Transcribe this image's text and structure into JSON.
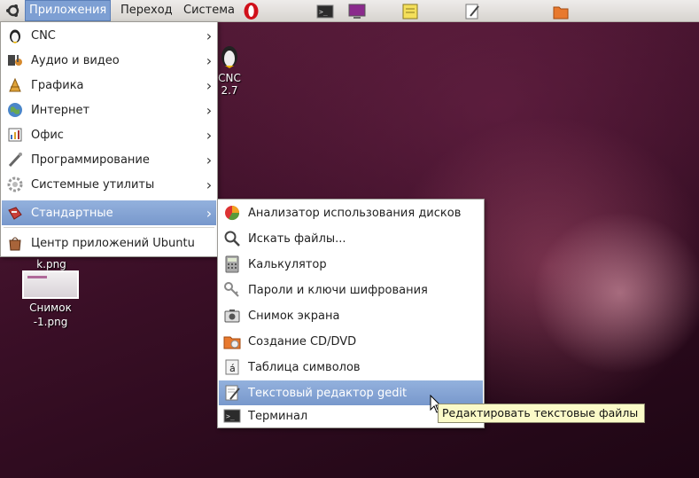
{
  "panel": {
    "menus": [
      {
        "label": "Приложения",
        "active": true
      },
      {
        "label": "Переход"
      },
      {
        "label": "Система"
      }
    ],
    "launchers": [
      "opera-icon",
      "terminal-icon",
      "screenshot-icon",
      "sticky-notes-icon",
      "text-editor-icon",
      "cd-burner-icon"
    ]
  },
  "main_menu": {
    "items": [
      {
        "label": "CNC",
        "icon": "cnc-icon",
        "submenu": true
      },
      {
        "label": "Аудио и видео",
        "icon": "audio-video-icon",
        "submenu": true
      },
      {
        "label": "Графика",
        "icon": "graphics-icon",
        "submenu": true
      },
      {
        "label": "Интернет",
        "icon": "internet-icon",
        "submenu": true
      },
      {
        "label": "Офис",
        "icon": "office-icon",
        "submenu": true
      },
      {
        "label": "Программирование",
        "icon": "programming-icon",
        "submenu": true
      },
      {
        "label": "Системные утилиты",
        "icon": "system-tools-icon",
        "submenu": true
      },
      {
        "label": "Стандартные",
        "icon": "accessories-icon",
        "submenu": true,
        "highlighted": true
      },
      {
        "label": "Центр приложений Ubuntu",
        "icon": "software-center-icon",
        "submenu": false
      }
    ]
  },
  "sub_menu": {
    "items": [
      {
        "label": "Анализатор использования дисков",
        "icon": "disk-usage-icon"
      },
      {
        "label": "Искать файлы...",
        "icon": "search-files-icon"
      },
      {
        "label": "Калькулятор",
        "icon": "calculator-icon"
      },
      {
        "label": "Пароли и ключи шифрования",
        "icon": "keys-icon"
      },
      {
        "label": "Снимок экрана",
        "icon": "camera-icon"
      },
      {
        "label": "Создание CD/DVD",
        "icon": "cd-dvd-icon"
      },
      {
        "label": "Таблица символов",
        "icon": "character-map-icon"
      },
      {
        "label": "Текстовый редактор gedit",
        "icon": "gedit-icon",
        "highlighted": true
      },
      {
        "label": "Терминал",
        "icon": "terminal-icon"
      }
    ]
  },
  "tooltip": "Редактировать текстовые файлы",
  "desktop": {
    "cnc_label_1": "CNC",
    "cnc_label_2": "2.7",
    "file1_label": "k.png",
    "file2_label_1": "Снимок",
    "file2_label_2": "-1.png"
  },
  "colors": {
    "highlight": "#7d9fd3",
    "tooltip_bg": "#fbfac8",
    "wallpaper": "#3b0f27"
  }
}
